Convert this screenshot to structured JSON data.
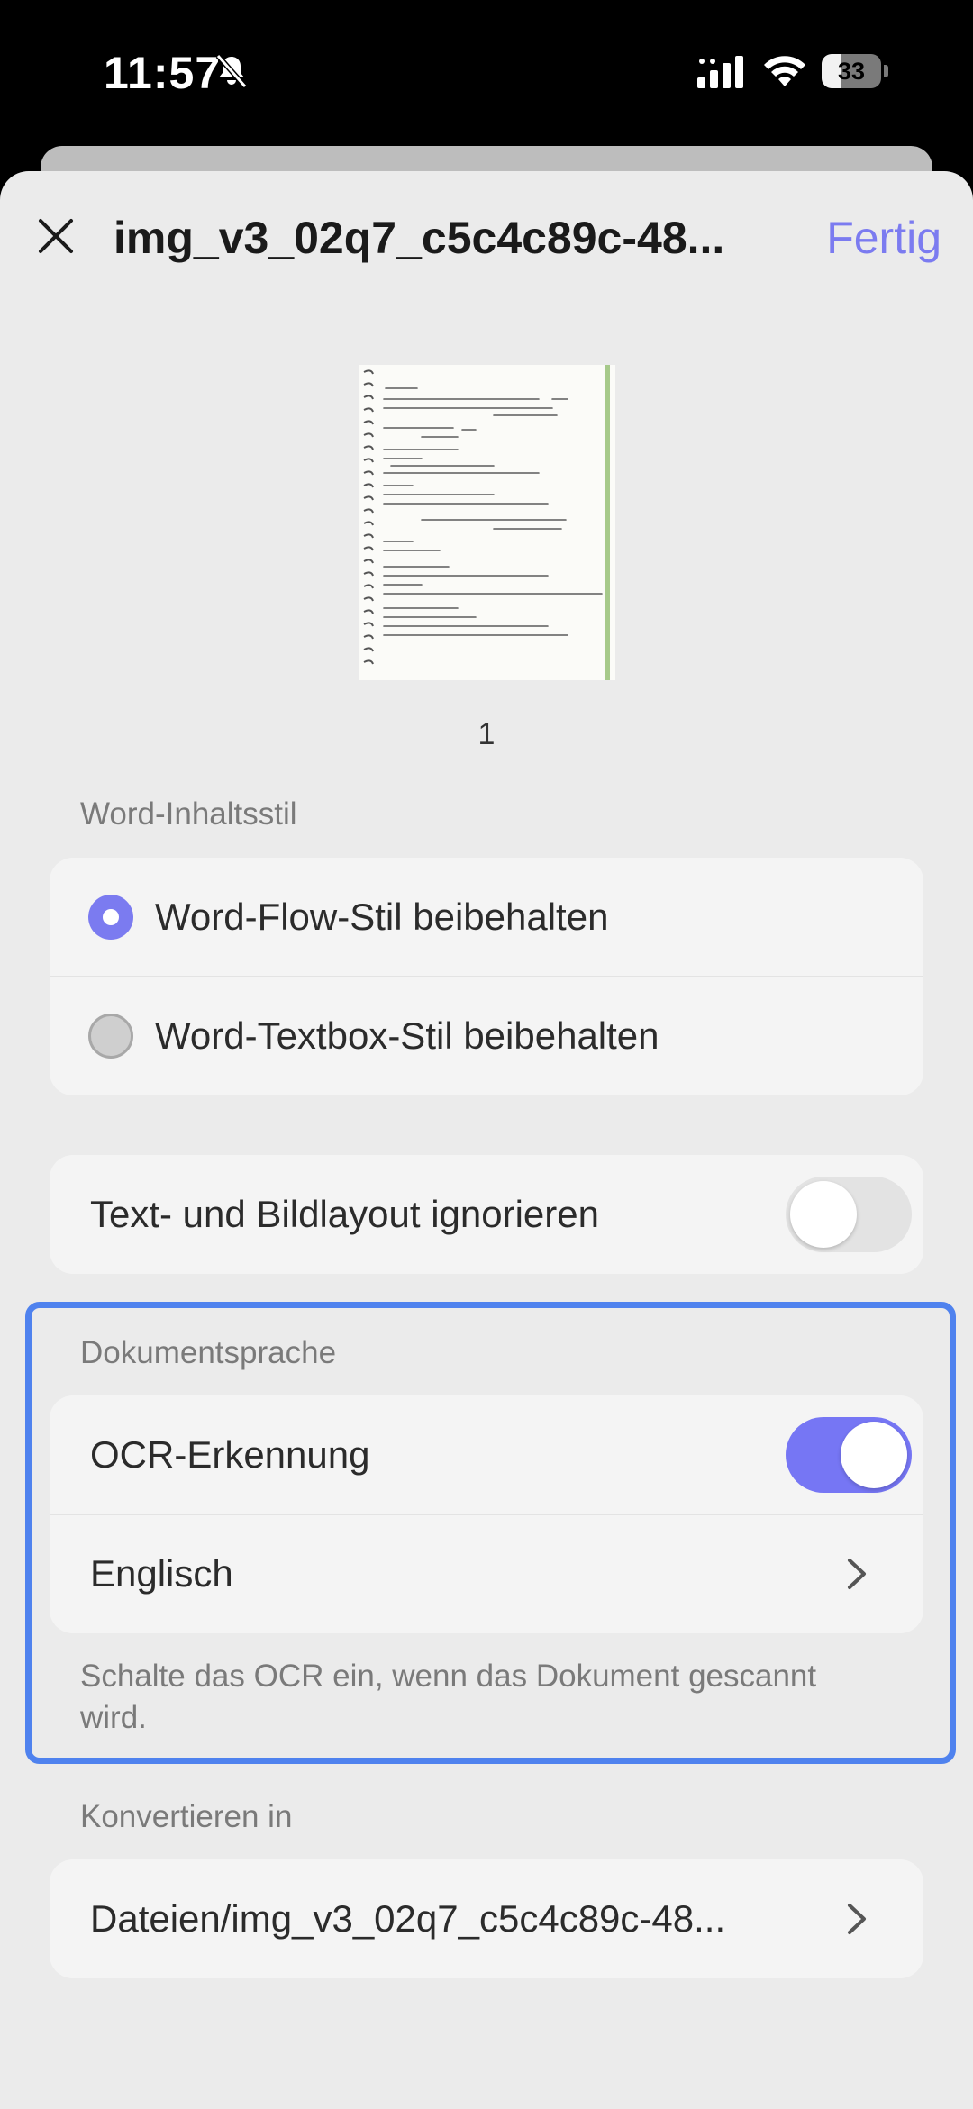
{
  "status_bar": {
    "time": "11:57",
    "battery": "33",
    "battery_level": 0.33,
    "icons": [
      "bell-slash-icon",
      "cellular-signal-icon",
      "wifi-icon",
      "battery-icon"
    ]
  },
  "header": {
    "title": "img_v3_02q7_c5c4c89c-48...",
    "done_label": "Fertig",
    "close_icon": "close-icon"
  },
  "preview": {
    "page_number": "1"
  },
  "content_style": {
    "label": "Word-Inhaltsstil",
    "options": [
      {
        "label": "Word-Flow-Stil beibehalten",
        "selected": true
      },
      {
        "label": "Word-Textbox-Stil beibehalten",
        "selected": false
      }
    ]
  },
  "layout_option": {
    "label": "Text- und Bildlayout ignorieren",
    "enabled": false
  },
  "document_language": {
    "label": "Dokumentsprache",
    "ocr_label": "OCR-Erkennung",
    "ocr_enabled": true,
    "language": "Englisch",
    "hint": "Schalte das OCR ein, wenn das Dokument gescannt wird."
  },
  "convert_to": {
    "label": "Konvertieren in",
    "path": "Dateien/img_v3_02q7_c5c4c89c-48..."
  },
  "colors": {
    "accent": "#7b7bf0",
    "highlight": "#4f82ee",
    "sheet_background": "#ebebeb",
    "card_background": "#f4f4f4"
  }
}
